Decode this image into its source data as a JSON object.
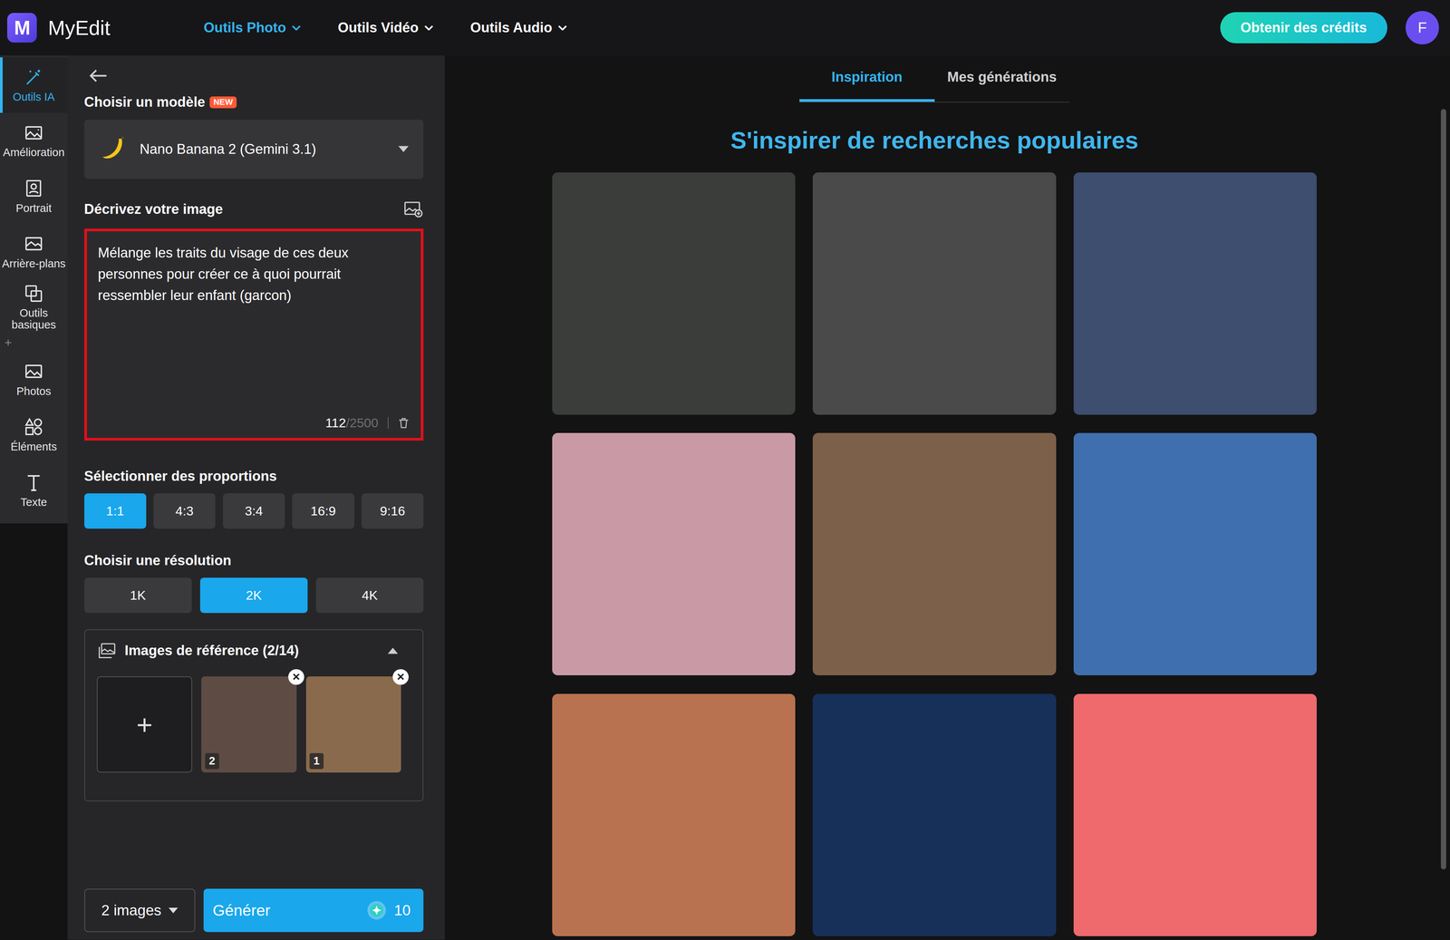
{
  "logo": {
    "mark": "M",
    "name": "MyEdit"
  },
  "nav": [
    {
      "label": "Outils Photo",
      "selected": true
    },
    {
      "label": "Outils Vidéo",
      "selected": false
    },
    {
      "label": "Outils Audio",
      "selected": false
    }
  ],
  "credits_button": "Obtenir des crédits",
  "avatar": "F",
  "rail": {
    "items": [
      {
        "label": "Outils IA",
        "selected": true
      },
      {
        "label": "Amélioration",
        "selected": false
      },
      {
        "label": "Portrait",
        "selected": false
      },
      {
        "label": "Arrière-plans",
        "selected": false
      },
      {
        "label": "Outils basiques",
        "selected": false
      },
      {
        "label": "Photos",
        "selected": false
      },
      {
        "label": "Éléments",
        "selected": false
      },
      {
        "label": "Texte",
        "selected": false
      }
    ],
    "separator": "+"
  },
  "panel": {
    "model_heading": "Choisir un modèle",
    "new_badge": "NEW",
    "model": "Nano Banana 2 (Gemini 3.1)",
    "prompt_heading": "Décrivez votre image",
    "prompt": "Mélange les traits du visage de ces deux personnes pour créer ce à quoi pourrait ressembler leur enfant (garcon)",
    "counter": "112",
    "counter_max": "/2500",
    "ratio_heading": "Sélectionner des proportions",
    "ratios": [
      {
        "label": "1:1",
        "selected": true
      },
      {
        "label": "4:3",
        "selected": false
      },
      {
        "label": "3:4",
        "selected": false
      },
      {
        "label": "16:9",
        "selected": false
      },
      {
        "label": "9:16",
        "selected": false
      }
    ],
    "resolution_heading": "Choisir une résolution",
    "resolutions": [
      {
        "label": "1K",
        "selected": false
      },
      {
        "label": "2K",
        "selected": true
      },
      {
        "label": "4K",
        "selected": false
      }
    ],
    "references": {
      "title": "Images de référence (2/14)",
      "expanded": true,
      "add": "+",
      "images": [
        {
          "number": "2",
          "close": "×",
          "color": "#5e4c44"
        },
        {
          "number": "1",
          "close": "×",
          "color": "#8a6a4c"
        }
      ]
    },
    "count_select": "2 images",
    "generate": {
      "label": "Générer",
      "cost": "10"
    }
  },
  "main": {
    "tabs": [
      {
        "label": "Inspiration",
        "selected": true
      },
      {
        "label": "Mes générations",
        "selected": false
      }
    ],
    "heading": "S'inspirer de recherches populaires",
    "gallery": [
      {
        "color": "#3b3d3a"
      },
      {
        "color": "#4a4a4a"
      },
      {
        "color": "#3d4e6e"
      },
      {
        "color": "#c99aa6"
      },
      {
        "color": "#7d6049"
      },
      {
        "color": "#3f6fae"
      },
      {
        "color": "#b9724f"
      },
      {
        "color": "#16305a"
      },
      {
        "color": "#ee6a6c"
      }
    ]
  }
}
